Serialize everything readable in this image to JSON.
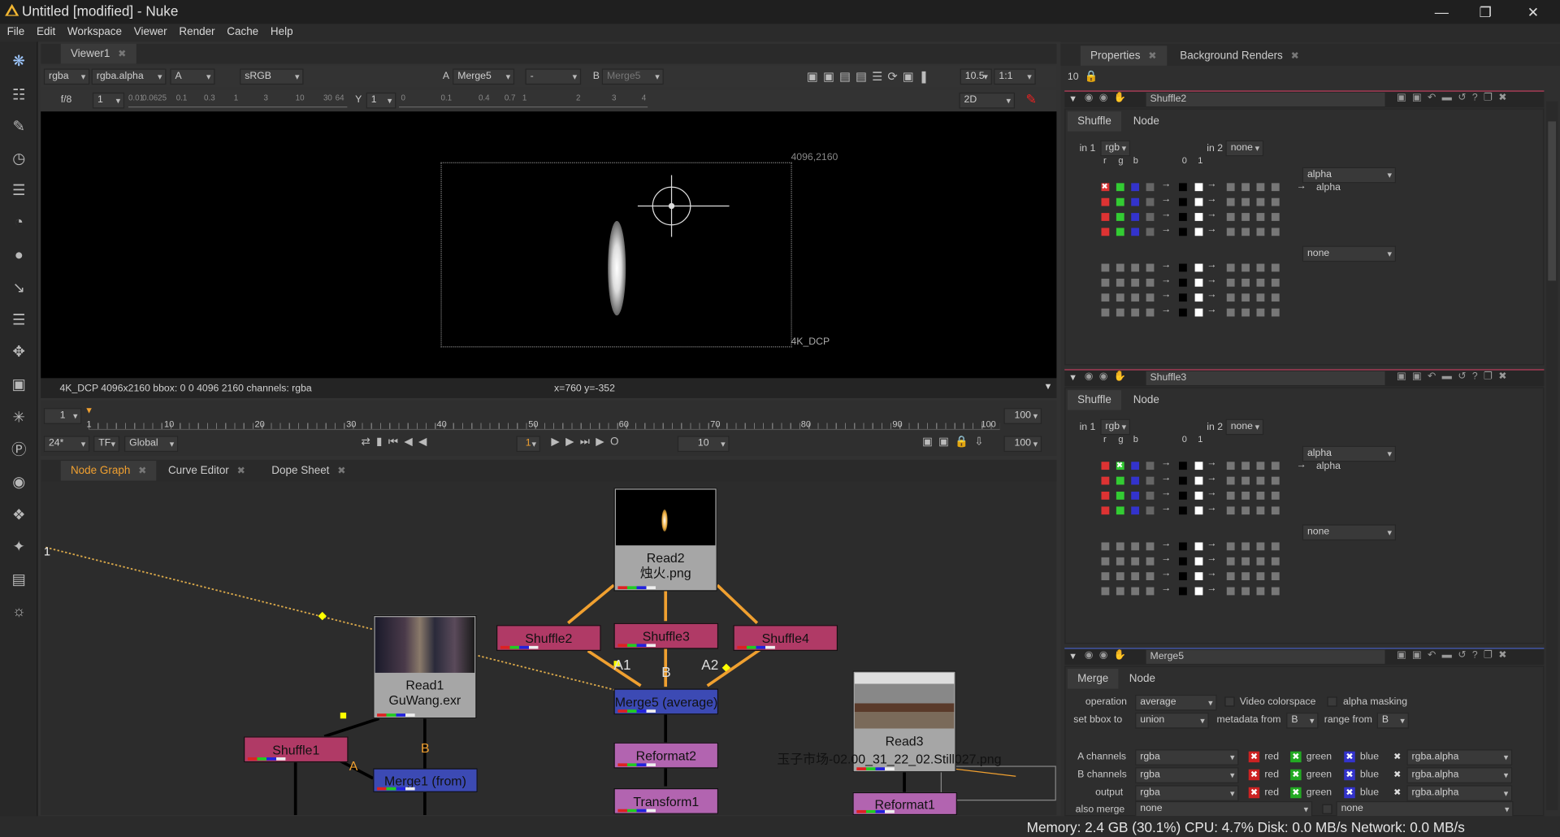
{
  "window": {
    "title": "Untitled [modified] - Nuke",
    "minimize": "—",
    "maximize": "❐",
    "close": "✕"
  },
  "menu": [
    "File",
    "Edit",
    "Workspace",
    "Viewer",
    "Render",
    "Cache",
    "Help"
  ],
  "viewer": {
    "tab": "Viewer1",
    "channels": "rgba",
    "layer": "rgba.alpha",
    "input_a": "A",
    "colorspace": "sRGB",
    "a_label": "A",
    "a_input": "Merge5",
    "mode": "-",
    "b_label": "B",
    "b_input": "Merge5",
    "zoom": "10.5",
    "ratio": "1:1",
    "fstop": "f/8",
    "gain": "1",
    "ruler_values": [
      "0.01",
      "0.0625",
      "0.1",
      "0.3",
      "1",
      "3",
      "10",
      "30",
      "64"
    ],
    "gamma_label": "Y",
    "gamma": "1",
    "gamma_ruler": [
      "0",
      "0.1",
      "0.4",
      "0.7",
      "1",
      "2",
      "3",
      "4"
    ],
    "view": "2D",
    "format_label": "4096,2160",
    "format_name": "4K_DCP",
    "info": "4K_DCP 4096x2160  bbox: 0 0 4096 2160 channels: rgba",
    "coords": "x=760 y=-352"
  },
  "timeline": {
    "start": "1",
    "end": "100",
    "ticks": [
      "1",
      "10",
      "20",
      "30",
      "40",
      "50",
      "60",
      "70",
      "80",
      "90",
      "100"
    ],
    "fps": "24*",
    "tf": "TF",
    "scope": "Global",
    "frame": "1",
    "step": "10",
    "end_field": "100"
  },
  "nodegraph": {
    "tabs": [
      "Node Graph",
      "Curve Editor",
      "Dope Sheet"
    ],
    "backdrop_label": "1",
    "nodes": {
      "read2": "Read2",
      "read2_file": "烛火.png",
      "read1": "Read1",
      "read1_file": "GuWang.exr",
      "read3": "Read3",
      "read3_file": "玉子市场-02.00_31_22_02.Still027.png",
      "shuffle1": "Shuffle1",
      "shuffle2": "Shuffle2",
      "shuffle3": "Shuffle3",
      "shuffle4": "Shuffle4",
      "merge5": "Merge5 (average)",
      "merge1": "Merge1 (from)",
      "reformat2": "Reformat2",
      "transform1": "Transform1",
      "reformat1": "Reformat1"
    },
    "pipe_labels": {
      "a1": "A1",
      "b": "B",
      "a2": "A2",
      "a": "A",
      "b2": "B"
    }
  },
  "properties": {
    "tabs": [
      "Properties",
      "Background Renders"
    ],
    "count": "10",
    "panels": [
      {
        "name": "Shuffle2",
        "tabs": [
          "Shuffle",
          "Node"
        ],
        "in1_label": "in 1",
        "in1": "rgb",
        "in2_label": "in 2",
        "in2": "none",
        "cols": [
          "r",
          "g",
          "b"
        ],
        "const_cols": [
          "0",
          "1"
        ],
        "out1": "alpha",
        "out1_label": "alpha",
        "out2": "none"
      },
      {
        "name": "Shuffle3",
        "tabs": [
          "Shuffle",
          "Node"
        ],
        "in1_label": "in 1",
        "in1": "rgb",
        "in2_label": "in 2",
        "in2": "none",
        "cols": [
          "r",
          "g",
          "b"
        ],
        "const_cols": [
          "0",
          "1"
        ],
        "out1": "alpha",
        "out1_label": "alpha",
        "out2": "none"
      }
    ],
    "merge": {
      "name": "Merge5",
      "tabs": [
        "Merge",
        "Node"
      ],
      "operation_label": "operation",
      "operation": "average",
      "video_colorspace": "Video colorspace",
      "alpha_masking": "alpha masking",
      "bbox_label": "set bbox to",
      "bbox": "union",
      "metadata_label": "metadata from",
      "metadata": "B",
      "range_label": "range from",
      "range": "B",
      "rows": [
        {
          "label": "A channels",
          "value": "rgba",
          "r": "red",
          "g": "green",
          "b": "blue",
          "alpha": "rgba.alpha"
        },
        {
          "label": "B channels",
          "value": "rgba",
          "r": "red",
          "g": "green",
          "b": "blue",
          "alpha": "rgba.alpha"
        },
        {
          "label": "output",
          "value": "rgba",
          "r": "red",
          "g": "green",
          "b": "blue",
          "alpha": "rgba.alpha"
        }
      ],
      "also_merge_label": "also merge",
      "also_merge": "none",
      "also_merge2": "none"
    }
  },
  "status": "Memory: 2.4 GB (30.1%) CPU: 4.7% Disk: 0.0 MB/s Network: 0.0 MB/s"
}
